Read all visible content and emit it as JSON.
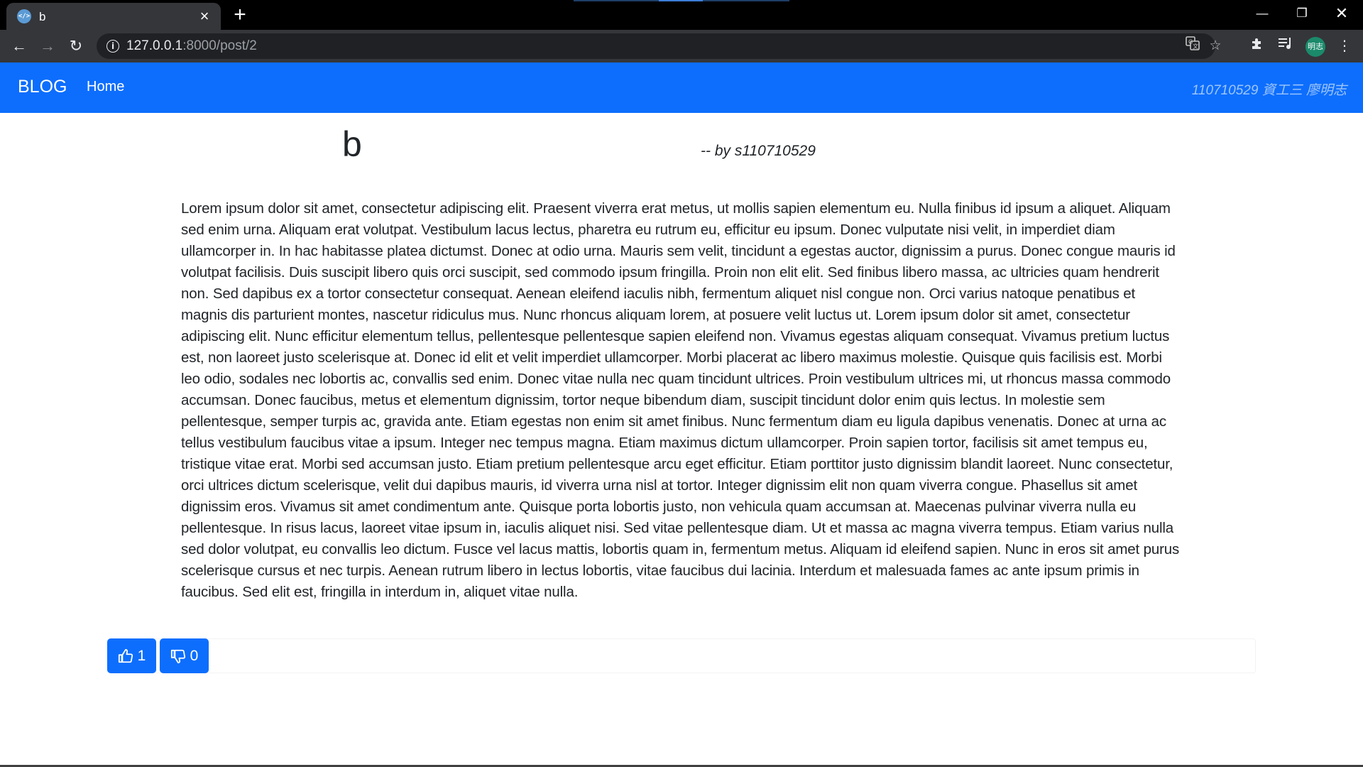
{
  "browser": {
    "tab_title": "b",
    "tab_favicon": "</>",
    "url_host": "127.0.0.1",
    "url_rest": ":8000/post/2",
    "profile_initials": "明志",
    "icons": [
      "back-icon",
      "forward-icon",
      "reload-icon",
      "info-icon",
      "translate-icon",
      "star-icon",
      "extensions-icon",
      "reading-list-icon",
      "menu-icon"
    ]
  },
  "navbar": {
    "brand": "BLOG",
    "home_link": "Home",
    "student_info": "110710529 資工三 廖明志",
    "color": "#0d6efd"
  },
  "post": {
    "title": "b",
    "author": "-- by s110710529",
    "body": "Lorem ipsum dolor sit amet, consectetur adipiscing elit. Praesent viverra erat metus, ut mollis sapien elementum eu. Nulla finibus id ipsum a aliquet. Aliquam sed enim urna. Aliquam erat volutpat. Vestibulum lacus lectus, pharetra eu rutrum eu, efficitur eu ipsum. Donec vulputate nisi velit, in imperdiet diam ullamcorper in. In hac habitasse platea dictumst. Donec at odio urna. Mauris sem velit, tincidunt a egestas auctor, dignissim a purus. Donec congue mauris id volutpat facilisis. Duis suscipit libero quis orci suscipit, sed commodo ipsum fringilla. Proin non elit elit. Sed finibus libero massa, ac ultricies quam hendrerit non. Sed dapibus ex a tortor consectetur consequat. Aenean eleifend iaculis nibh, fermentum aliquet nisl congue non. Orci varius natoque penatibus et magnis dis parturient montes, nascetur ridiculus mus. Nunc rhoncus aliquam lorem, at posuere velit luctus ut. Lorem ipsum dolor sit amet, consectetur adipiscing elit. Nunc efficitur elementum tellus, pellentesque pellentesque sapien eleifend non. Vivamus egestas aliquam consequat. Vivamus pretium luctus est, non laoreet justo scelerisque at. Donec id elit et velit imperdiet ullamcorper. Morbi placerat ac libero maximus molestie. Quisque quis facilisis est. Morbi leo odio, sodales nec lobortis ac, convallis sed enim. Donec vitae nulla nec quam tincidunt ultrices. Proin vestibulum ultrices mi, ut rhoncus massa commodo accumsan. Donec faucibus, metus et elementum dignissim, tortor neque bibendum diam, suscipit tincidunt dolor enim quis lectus. In molestie sem pellentesque, semper turpis ac, gravida ante. Etiam egestas non enim sit amet finibus. Nunc fermentum diam eu ligula dapibus venenatis. Donec at urna ac tellus vestibulum faucibus vitae a ipsum. Integer nec tempus magna. Etiam maximus dictum ullamcorper. Proin sapien tortor, facilisis sit amet tempus eu, tristique vitae erat. Morbi sed accumsan justo. Etiam pretium pellentesque arcu eget efficitur. Etiam porttitor justo dignissim blandit laoreet. Nunc consectetur, orci ultrices dictum scelerisque, velit dui dapibus mauris, id viverra urna nisl at tortor. Integer dignissim elit non quam viverra congue. Phasellus sit amet dignissim eros. Vivamus sit amet condimentum ante. Quisque porta lobortis justo, non vehicula quam accumsan at. Maecenas pulvinar viverra nulla eu pellentesque. In risus lacus, laoreet vitae ipsum in, iaculis aliquet nisi. Sed vitae pellentesque diam. Ut et massa ac magna viverra tempus. Etiam varius nulla sed dolor volutpat, eu convallis leo dictum. Fusce vel lacus mattis, lobortis quam in, fermentum metus. Aliquam id eleifend sapien. Nunc in eros sit amet purus scelerisque cursus et nec turpis. Aenean rutrum libero in lectus lobortis, vitae faucibus dui lacinia. Interdum et malesuada fames ac ante ipsum primis in faucibus. Sed elit est, fringilla in interdum in, aliquet vitae nulla."
  },
  "votes": {
    "likes": "1",
    "dislikes": "0",
    "like_icon": "thumbs-up-icon",
    "dislike_icon": "thumbs-down-icon"
  }
}
